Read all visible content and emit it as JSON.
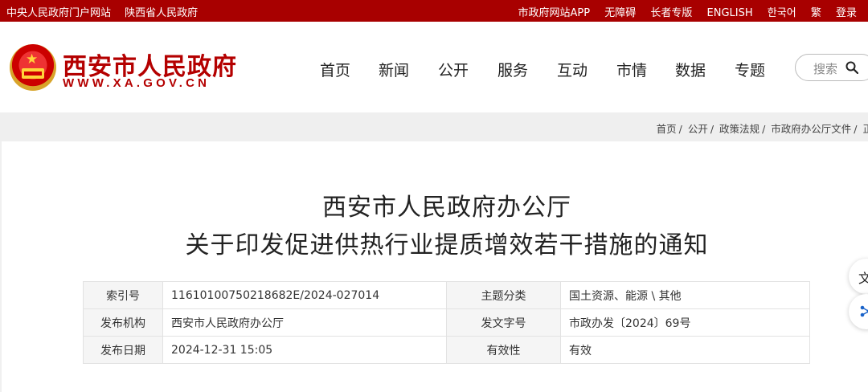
{
  "topbar": {
    "left_links": [
      "中央人民政府门户网站",
      "陕西省人民政府"
    ],
    "right_links": [
      "市政府网站APP",
      "无障碍",
      "长者专版",
      "ENGLISH",
      "한국어",
      "繁",
      "登录"
    ]
  },
  "header": {
    "site_name": "西安市人民政府",
    "site_url": "WWW.XA.GOV.CN",
    "nav": [
      "首页",
      "新闻",
      "公开",
      "服务",
      "互动",
      "市情",
      "数据",
      "专题"
    ],
    "search_placeholder": "搜索"
  },
  "breadcrumb": [
    "首页",
    "公开",
    "政策法规",
    "市政府办公厅文件",
    "正"
  ],
  "article": {
    "title_line1": "西安市人民政府办公厅",
    "title_line2": "关于印发促进供热行业提质增效若干措施的通知"
  },
  "meta_table": [
    {
      "k1": "索引号",
      "v1": "11610100750218682E/2024-027014",
      "k2": "主题分类",
      "v2": "国土资源、能源 \\ 其他"
    },
    {
      "k1": "发布机构",
      "v1": "西安市人民政府办公厅",
      "k2": "发文字号",
      "v2": "市政办发〔2024〕69号"
    },
    {
      "k1": "发布日期",
      "v1": "2024-12-31 15:05",
      "k2": "有效性",
      "v2": "有效"
    }
  ],
  "floating": {
    "btn_a_glyph": "文"
  },
  "colors": {
    "brand_red": "#a80000",
    "logo_red": "#b40000"
  }
}
